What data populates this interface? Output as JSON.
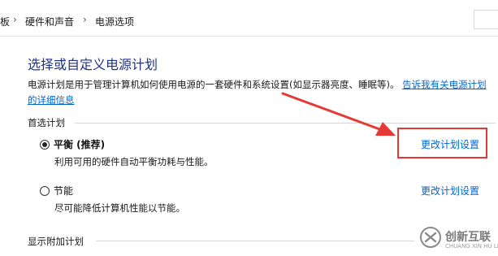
{
  "breadcrumb": {
    "items": [
      "板",
      "硬件和声音",
      "电源选项"
    ],
    "separator": "›"
  },
  "page": {
    "title": "选择或自定义电源计划",
    "description": "电源计划是用于管理计算机如何使用电源的一套硬件和系统设置(如显示器亮度、睡眠等)。",
    "description_link": "告诉我有关电源计划的详细信息"
  },
  "sections": {
    "preferred_label": "首选计划",
    "additional_label": "显示附加计划"
  },
  "plans": [
    {
      "name": "平衡 (推荐)",
      "description": "利用可用的硬件自动平衡功耗与性能。",
      "selected": true,
      "change_link": "更改计划设置"
    },
    {
      "name": "节能",
      "description": "尽可能降低计算机性能以节能。",
      "selected": false,
      "change_link": "更改计划设置"
    }
  ],
  "annotation": {
    "color": "#e53935"
  },
  "watermark": {
    "brand": "创新互联",
    "sub": "CHUANG XIN HU LIAN"
  },
  "colors": {
    "title": "#1e3287",
    "link": "#0066cc",
    "annotation_red": "#e53935"
  }
}
